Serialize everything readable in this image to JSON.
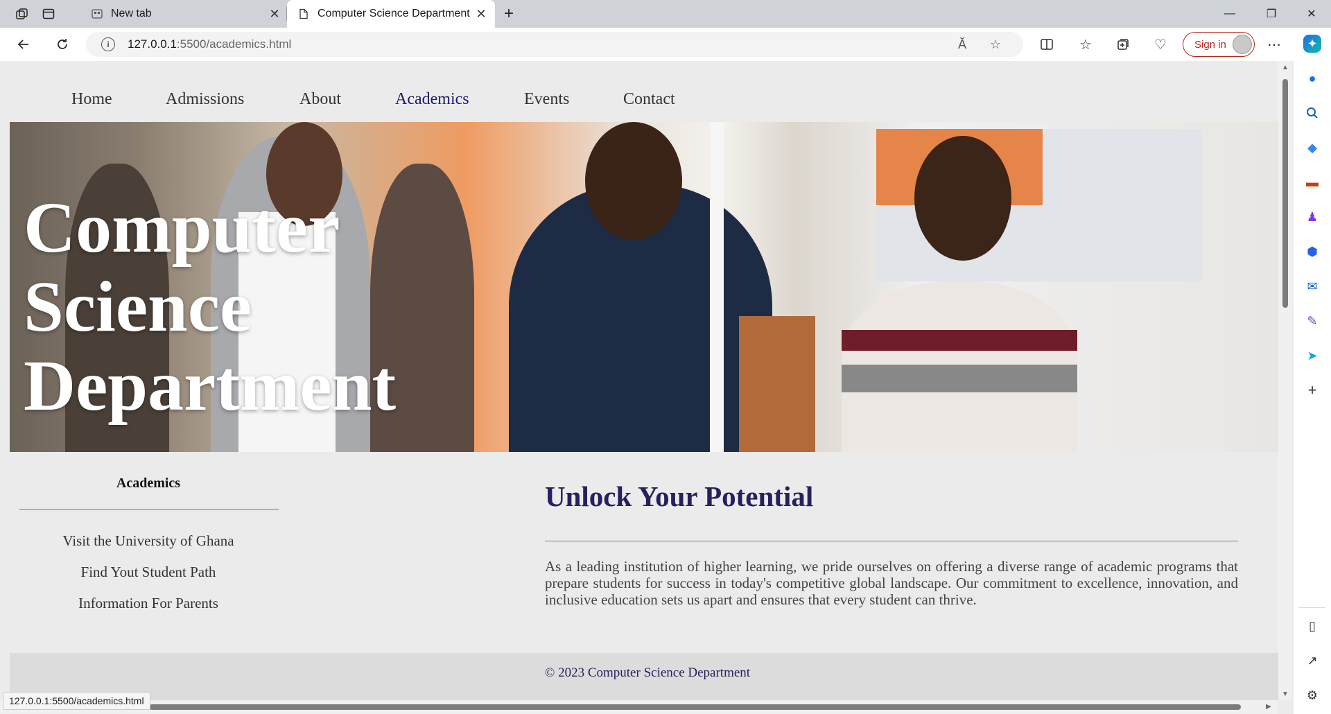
{
  "browser": {
    "tabs": [
      {
        "title": "New tab",
        "active": false
      },
      {
        "title": "Computer Science Department",
        "active": true
      }
    ],
    "address": {
      "host": "127.0.0.1",
      "rest": ":5500/academics.html"
    },
    "sign_in_label": "Sign in",
    "status_url": "127.0.0.1:5500/academics.html",
    "read_aloud_glyph": "Ă"
  },
  "nav": {
    "items": [
      "Home",
      "Admissions",
      "About",
      "Academics",
      "Events",
      "Contact"
    ],
    "active": "Academics"
  },
  "hero": {
    "title": "Computer\nScience\nDepartment"
  },
  "aside": {
    "title": "Academics",
    "links": [
      "Visit the University of Ghana",
      "Find Yout Student Path",
      "Information For Parents"
    ]
  },
  "main": {
    "heading": "Unlock Your Potential",
    "body": "As a leading institution of higher learning, we pride ourselves on offering a diverse range of academic programs that prepare students for success in today's competitive global landscape. Our commitment to excellence, innovation, and inclusive education sets us apart and ensures that every student can thrive."
  },
  "footer": {
    "text": "© 2023 Computer Science Department"
  },
  "colors": {
    "accent": "#1e1b6e",
    "heading": "#25215e",
    "signin": "#b3261e"
  }
}
